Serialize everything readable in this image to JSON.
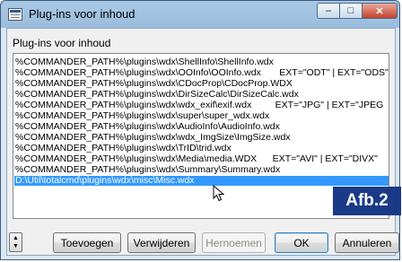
{
  "window": {
    "title": "Plug-ins voor inhoud"
  },
  "dialog": {
    "list_label": "Plug-ins voor inhoud",
    "items": [
      "%COMMANDER_PATH%\\plugins\\wdx\\ShellInfo\\ShellInfo.wdx",
      "%COMMANDER_PATH%\\plugins\\wdx\\OOInfo\\OOInfo.wdx       EXT=\"ODT\" | EXT=\"ODS\"",
      "%COMMANDER_PATH%\\plugins\\wdx\\CDocProp\\CDocProp.WDX",
      "%COMMANDER_PATH%\\plugins\\wdx\\DirSizeCalc\\DirSizeCalc.wdx",
      "%COMMANDER_PATH%\\plugins\\wdx\\wdx_exif\\exif.wdx         EXT=\"JPG\" | EXT=\"JPEG",
      "%COMMANDER_PATH%\\plugins\\wdx\\super\\super_wdx.wdx",
      "%COMMANDER_PATH%\\plugins\\wdx\\AudioInfo\\AudioInfo.wdx",
      "%COMMANDER_PATH%\\plugins\\wdx\\wdx_ImgSize\\ImgSize.wdx",
      "%COMMANDER_PATH%\\plugins\\wdx\\TrID\\trid.wdx",
      "%COMMANDER_PATH%\\plugins\\wdx\\Media\\media.WDX      EXT=\"AVI\" | EXT=\"DIVX\"",
      "%COMMANDER_PATH%\\plugins\\wdx\\Summary\\Summary.wdx",
      "D:\\Util\\totalcmd\\plugins\\wdx\\misc\\Misc.wdx"
    ],
    "selected_index": 11
  },
  "badge": {
    "text": "Afb.2"
  },
  "buttons": {
    "add": "Toevoegen",
    "remove": "Verwijderen",
    "rename": "Hernoemen",
    "ok": "OK",
    "cancel": "Annuleren"
  },
  "spinner": {
    "up": "▲",
    "down": "▼"
  },
  "caption": {
    "minimize": "–",
    "maximize": "□",
    "close": "✕"
  },
  "icons": {
    "app": "document-list-icon",
    "cursor": "mouse-pointer-icon"
  }
}
